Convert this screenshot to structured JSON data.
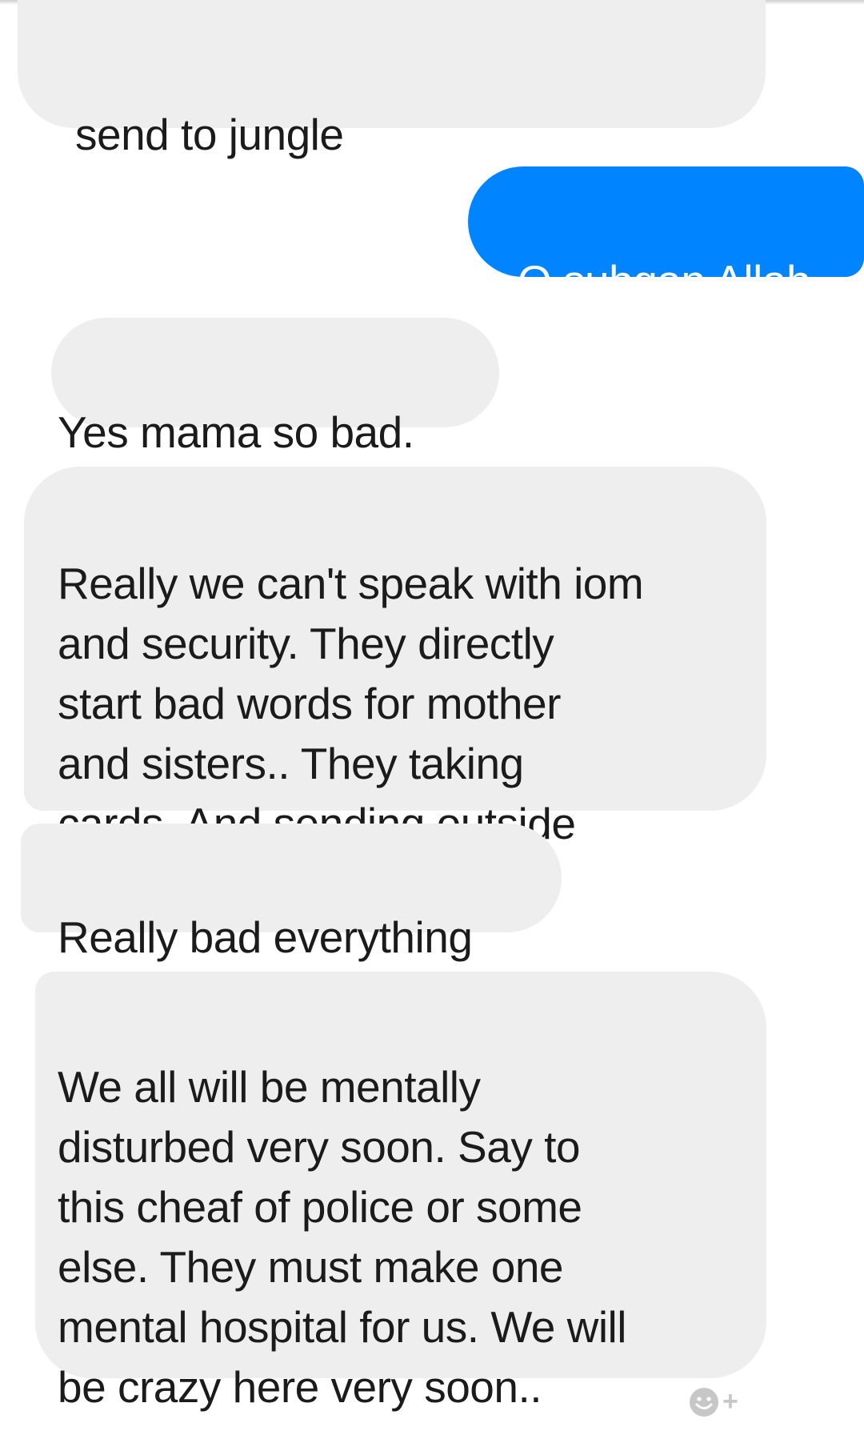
{
  "colors": {
    "received_bubble": "#eeeeee",
    "sent_bubble": "#0084ff",
    "text": "#1b1b1b",
    "sent_text": "#ffffff"
  },
  "messages": [
    {
      "sender": "other",
      "text": "send to jungle"
    },
    {
      "sender": "me",
      "text": "O subgan Allah"
    },
    {
      "sender": "other",
      "text": "Yes mama so bad."
    },
    {
      "sender": "other",
      "text": "Really we can't speak with iom\nand security.  They directly\nstart bad words for mother\nand sisters..  They taking\ncards.  And sending outside"
    },
    {
      "sender": "other",
      "text": "Really bad everything"
    },
    {
      "sender": "other",
      "text": "We all will be mentally\ndisturbed very soon.  Say to\nthis cheaf of police or some\nelse.  They must make one\nmental hospital for us. We will\nbe crazy here very soon.."
    }
  ],
  "reaction_button": {
    "icon": "smiley-add-icon",
    "label": "+"
  }
}
